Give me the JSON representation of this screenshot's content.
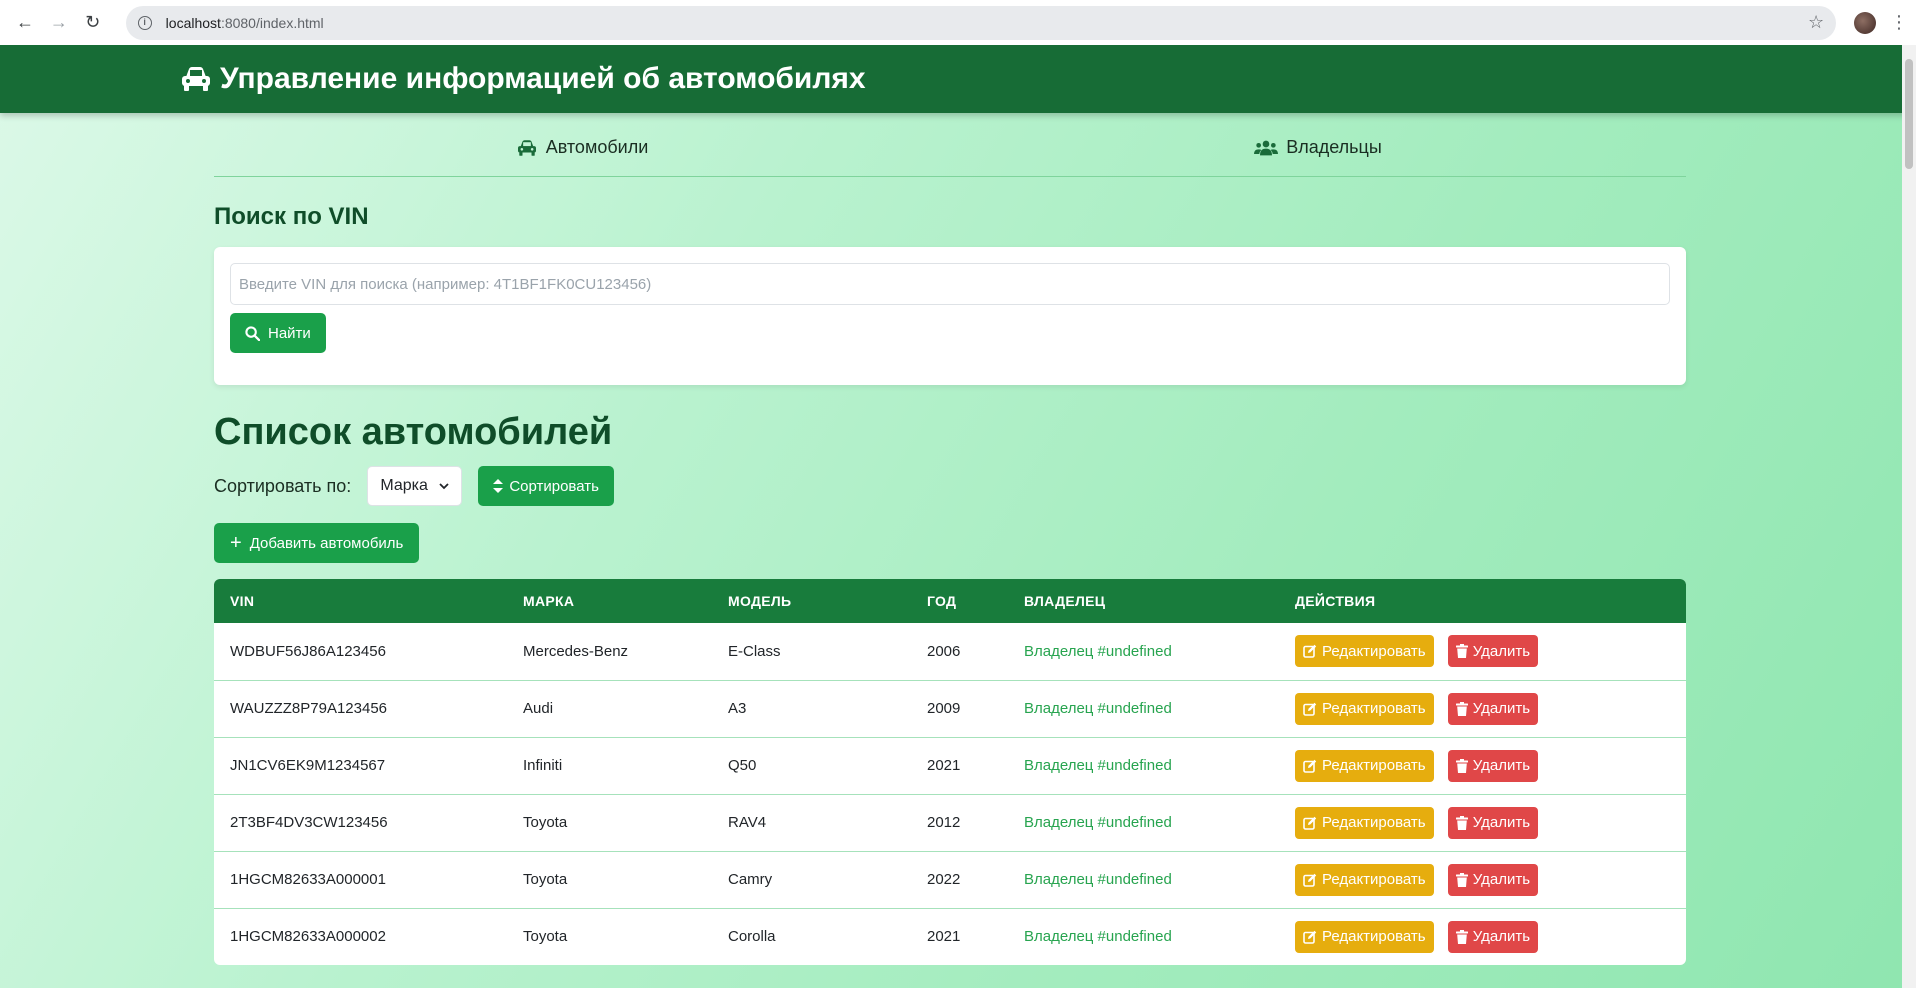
{
  "browser": {
    "url_host": "localhost",
    "url_rest": ":8080/index.html"
  },
  "header": {
    "title": "Управление информацией об автомобилях"
  },
  "tabs": [
    {
      "label": "Автомобили",
      "icon": "car-icon"
    },
    {
      "label": "Владельцы",
      "icon": "users-icon"
    }
  ],
  "search": {
    "title": "Поиск по VIN",
    "placeholder": "Введите VIN для поиска (например: 4T1BF1FK0CU123456)",
    "button_label": "Найти"
  },
  "list": {
    "title": "Список автомобилей",
    "sort_label": "Сортировать по:",
    "sort_value": "Марка",
    "sort_button": "Сортировать",
    "add_button": "Добавить автомобиль"
  },
  "table": {
    "headers": [
      "VIN",
      "МАРКА",
      "МОДЕЛЬ",
      "ГОД",
      "ВЛАДЕЛЕЦ",
      "ДЕЙСТВИЯ"
    ],
    "edit_label": "Редактировать",
    "delete_label": "Удалить",
    "rows": [
      {
        "vin": "WDBUF56J86A123456",
        "make": "Mercedes-Benz",
        "model": "E-Class",
        "year": "2006",
        "owner": "Владелец #undefined"
      },
      {
        "vin": "WAUZZZ8P79A123456",
        "make": "Audi",
        "model": "A3",
        "year": "2009",
        "owner": "Владелец #undefined"
      },
      {
        "vin": "JN1CV6EK9M1234567",
        "make": "Infiniti",
        "model": "Q50",
        "year": "2021",
        "owner": "Владелец #undefined"
      },
      {
        "vin": "2T3BF4DV3CW123456",
        "make": "Toyota",
        "model": "RAV4",
        "year": "2012",
        "owner": "Владелец #undefined"
      },
      {
        "vin": "1HGCM82633A000001",
        "make": "Toyota",
        "model": "Camry",
        "year": "2022",
        "owner": "Владелец #undefined"
      },
      {
        "vin": "1HGCM82633A000002",
        "make": "Toyota",
        "model": "Corolla",
        "year": "2021",
        "owner": "Владелец #undefined"
      }
    ]
  },
  "colors": {
    "header_bg": "#176c36",
    "table_header_bg": "#187c3c",
    "primary_button": "#1aa04a",
    "edit_button": "#e6ad0e",
    "delete_button": "#e04748",
    "owner_link": "#27a44f"
  }
}
